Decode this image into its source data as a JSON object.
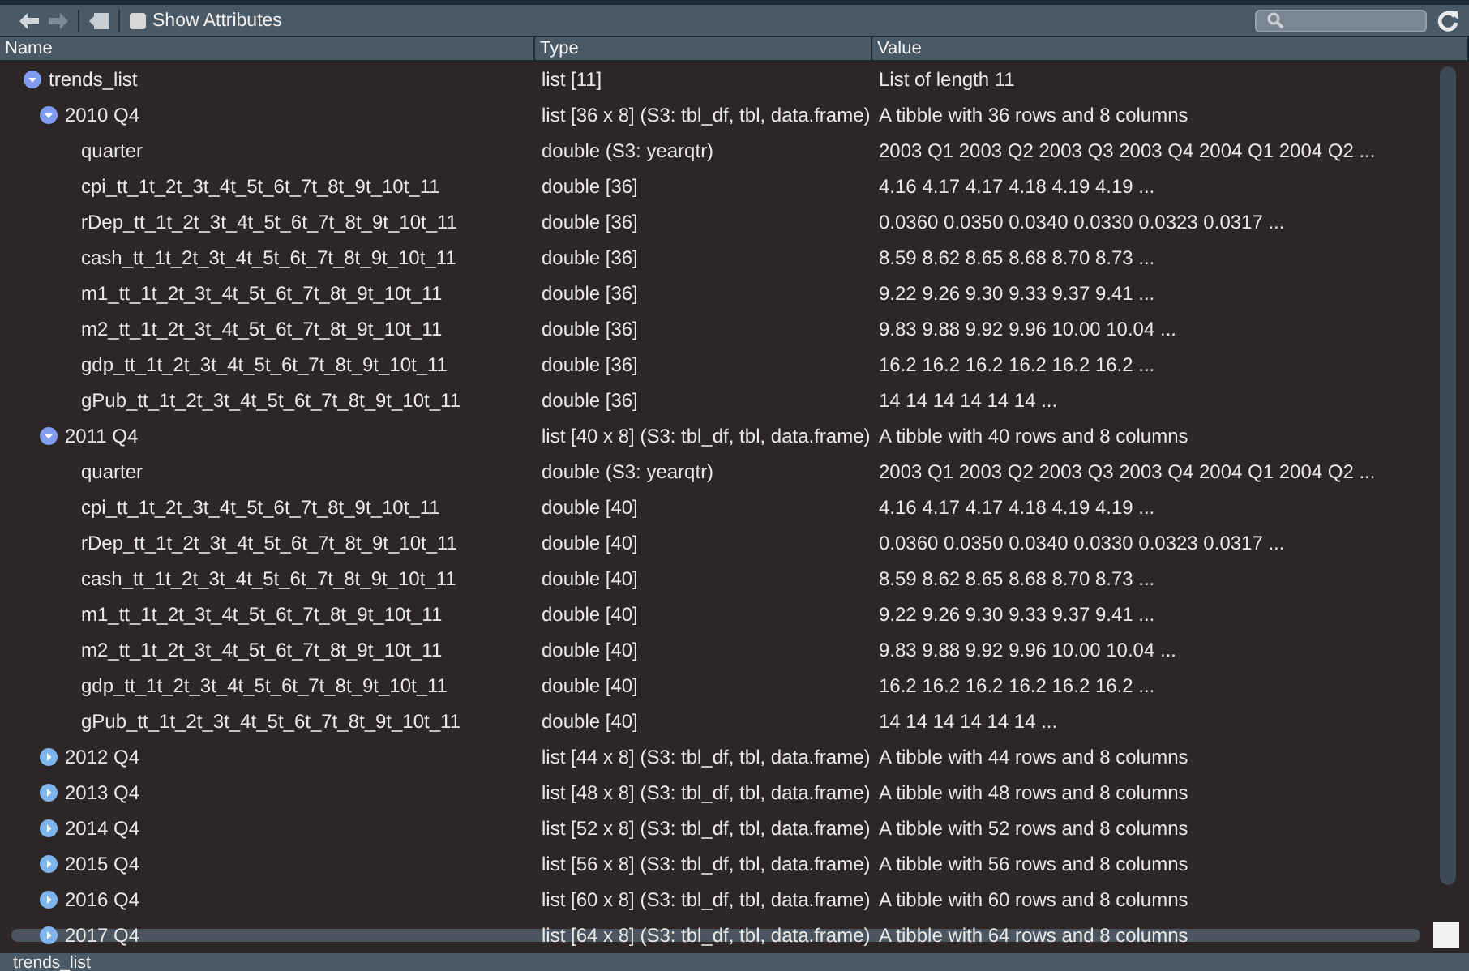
{
  "toolbar": {
    "show_attributes": {
      "label": "Show Attributes",
      "checked": false
    }
  },
  "columns": [
    "Name",
    "Type",
    "Value"
  ],
  "tree": [
    {
      "name": "trends_list",
      "type": "list [11]",
      "value": "List of length 11",
      "expanded": true,
      "children": [
        {
          "name": "2010 Q4",
          "type": "list [36 x 8] (S3: tbl_df, tbl, data.frame)",
          "value": "A tibble with 36 rows and 8 columns",
          "expanded": true,
          "children": [
            {
              "name": "quarter",
              "type": "double (S3: yearqtr)",
              "value": "2003 Q1 2003 Q2 2003 Q3 2003 Q4 2004 Q1 2004 Q2 ..."
            },
            {
              "name": "cpi_tt_1t_2t_3t_4t_5t_6t_7t_8t_9t_10t_11",
              "type": "double [36]",
              "value": "4.16 4.17 4.17 4.18 4.19 4.19 ..."
            },
            {
              "name": "rDep_tt_1t_2t_3t_4t_5t_6t_7t_8t_9t_10t_11",
              "type": "double [36]",
              "value": "0.0360 0.0350 0.0340 0.0330 0.0323 0.0317 ..."
            },
            {
              "name": "cash_tt_1t_2t_3t_4t_5t_6t_7t_8t_9t_10t_11",
              "type": "double [36]",
              "value": "8.59 8.62 8.65 8.68 8.70 8.73 ..."
            },
            {
              "name": "m1_tt_1t_2t_3t_4t_5t_6t_7t_8t_9t_10t_11",
              "type": "double [36]",
              "value": "9.22 9.26 9.30 9.33 9.37 9.41 ..."
            },
            {
              "name": "m2_tt_1t_2t_3t_4t_5t_6t_7t_8t_9t_10t_11",
              "type": "double [36]",
              "value": "9.83 9.88 9.92 9.96 10.00 10.04 ..."
            },
            {
              "name": "gdp_tt_1t_2t_3t_4t_5t_6t_7t_8t_9t_10t_11",
              "type": "double [36]",
              "value": "16.2 16.2 16.2 16.2 16.2 16.2 ..."
            },
            {
              "name": "gPub_tt_1t_2t_3t_4t_5t_6t_7t_8t_9t_10t_11",
              "type": "double [36]",
              "value": "14 14 14 14 14 14 ..."
            }
          ]
        },
        {
          "name": "2011 Q4",
          "type": "list [40 x 8] (S3: tbl_df, tbl, data.frame)",
          "value": "A tibble with 40 rows and 8 columns",
          "expanded": true,
          "children": [
            {
              "name": "quarter",
              "type": "double (S3: yearqtr)",
              "value": "2003 Q1 2003 Q2 2003 Q3 2003 Q4 2004 Q1 2004 Q2 ..."
            },
            {
              "name": "cpi_tt_1t_2t_3t_4t_5t_6t_7t_8t_9t_10t_11",
              "type": "double [40]",
              "value": "4.16 4.17 4.17 4.18 4.19 4.19 ..."
            },
            {
              "name": "rDep_tt_1t_2t_3t_4t_5t_6t_7t_8t_9t_10t_11",
              "type": "double [40]",
              "value": "0.0360 0.0350 0.0340 0.0330 0.0323 0.0317 ..."
            },
            {
              "name": "cash_tt_1t_2t_3t_4t_5t_6t_7t_8t_9t_10t_11",
              "type": "double [40]",
              "value": "8.59 8.62 8.65 8.68 8.70 8.73 ..."
            },
            {
              "name": "m1_tt_1t_2t_3t_4t_5t_6t_7t_8t_9t_10t_11",
              "type": "double [40]",
              "value": "9.22 9.26 9.30 9.33 9.37 9.41 ..."
            },
            {
              "name": "m2_tt_1t_2t_3t_4t_5t_6t_7t_8t_9t_10t_11",
              "type": "double [40]",
              "value": "9.83 9.88 9.92 9.96 10.00 10.04 ..."
            },
            {
              "name": "gdp_tt_1t_2t_3t_4t_5t_6t_7t_8t_9t_10t_11",
              "type": "double [40]",
              "value": "16.2 16.2 16.2 16.2 16.2 16.2 ..."
            },
            {
              "name": "gPub_tt_1t_2t_3t_4t_5t_6t_7t_8t_9t_10t_11",
              "type": "double [40]",
              "value": "14 14 14 14 14 14 ..."
            }
          ]
        },
        {
          "name": "2012 Q4",
          "type": "list [44 x 8] (S3: tbl_df, tbl, data.frame)",
          "value": "A tibble with 44 rows and 8 columns",
          "expanded": false
        },
        {
          "name": "2013 Q4",
          "type": "list [48 x 8] (S3: tbl_df, tbl, data.frame)",
          "value": "A tibble with 48 rows and 8 columns",
          "expanded": false
        },
        {
          "name": "2014 Q4",
          "type": "list [52 x 8] (S3: tbl_df, tbl, data.frame)",
          "value": "A tibble with 52 rows and 8 columns",
          "expanded": false
        },
        {
          "name": "2015 Q4",
          "type": "list [56 x 8] (S3: tbl_df, tbl, data.frame)",
          "value": "A tibble with 56 rows and 8 columns",
          "expanded": false
        },
        {
          "name": "2016 Q4",
          "type": "list [60 x 8] (S3: tbl_df, tbl, data.frame)",
          "value": "A tibble with 60 rows and 8 columns",
          "expanded": false
        },
        {
          "name": "2017 Q4",
          "type": "list [64 x 8] (S3: tbl_df, tbl, data.frame)",
          "value": "A tibble with 64 rows and 8 columns",
          "expanded": false
        }
      ]
    }
  ],
  "status_bar": "trends_list"
}
